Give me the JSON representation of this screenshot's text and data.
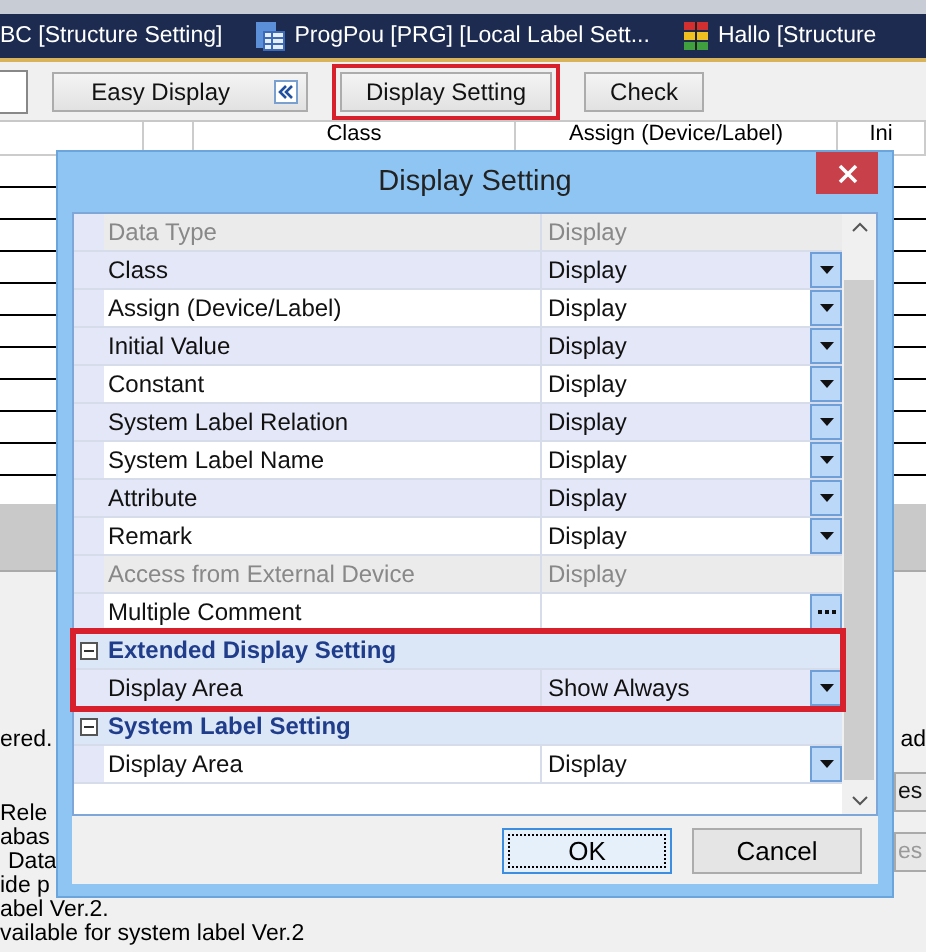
{
  "tabs": [
    {
      "label": "BC [Structure Setting]",
      "kind": "plain"
    },
    {
      "label": "ProgPou [PRG] [Local Label Sett...",
      "kind": "program"
    },
    {
      "label": "Hallo [Structure",
      "kind": "structure"
    }
  ],
  "toolbar": {
    "buttons": [
      {
        "label": "Easy Display",
        "kind": "collapse",
        "highlighted": false
      },
      {
        "label": "Display Setting",
        "kind": "plain",
        "highlighted": true
      },
      {
        "label": "Check",
        "kind": "plain",
        "highlighted": false
      }
    ]
  },
  "table": {
    "columns": [
      "Class",
      "Assign (Device/Label)",
      "Ini"
    ]
  },
  "messages": [
    "ered.",
    "Rele",
    "abas",
    "Data",
    "ide p",
    "abel Ver.2.",
    "vailable for system label Ver.2"
  ],
  "side_texts": [
    {
      "label": "ad",
      "kind": "text"
    },
    {
      "label": "es",
      "kind": "button",
      "disabled": false
    },
    {
      "label": "es",
      "kind": "button",
      "disabled": true
    }
  ],
  "dialog": {
    "title": "Display Setting",
    "sections": [
      {
        "rows": [
          {
            "name": "Data Type",
            "value": "Display",
            "disabled": true,
            "kind": "readonly"
          },
          {
            "name": "Class",
            "value": "Display",
            "disabled": false,
            "kind": "dropdown"
          },
          {
            "name": "Assign (Device/Label)",
            "value": "Display",
            "disabled": false,
            "kind": "dropdown"
          },
          {
            "name": "Initial Value",
            "value": "Display",
            "disabled": false,
            "kind": "dropdown"
          },
          {
            "name": "Constant",
            "value": "Display",
            "disabled": false,
            "kind": "dropdown"
          },
          {
            "name": "System Label Relation",
            "value": "Display",
            "disabled": false,
            "kind": "dropdown"
          },
          {
            "name": "System Label Name",
            "value": "Display",
            "disabled": false,
            "kind": "dropdown"
          },
          {
            "name": "Attribute",
            "value": "Display",
            "disabled": false,
            "kind": "dropdown"
          },
          {
            "name": "Remark",
            "value": "Display",
            "disabled": false,
            "kind": "dropdown"
          },
          {
            "name": "Access from External Device",
            "value": "Display",
            "disabled": true,
            "kind": "readonly"
          },
          {
            "name": "Multiple Comment",
            "disabled": false,
            "kind": "ellipsis"
          }
        ]
      },
      {
        "title": "Extended Display Setting",
        "expanded": true,
        "highlighted": true,
        "rows": [
          {
            "name": "Display Area",
            "value": "Show Always",
            "disabled": false,
            "kind": "dropdown"
          }
        ]
      },
      {
        "title": "System Label Setting",
        "expanded": true,
        "highlighted": false,
        "rows": [
          {
            "name": "Display Area",
            "value": "Display",
            "disabled": false,
            "kind": "dropdown"
          }
        ]
      }
    ],
    "buttons": [
      {
        "label": "OK",
        "focused": true
      },
      {
        "label": "Cancel",
        "focused": false
      }
    ]
  }
}
